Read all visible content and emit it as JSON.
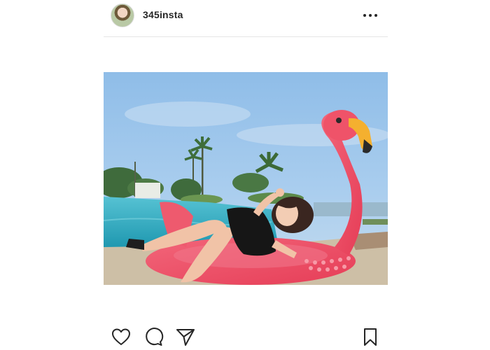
{
  "post": {
    "username": "345insta"
  },
  "icons": {
    "avatar": "profile-photo",
    "more": "more-options-icon",
    "like": "heart-icon",
    "comment": "comment-icon",
    "share": "paper-plane-icon",
    "save": "bookmark-icon"
  },
  "colors": {
    "text": "#262626",
    "divider": "#e6e6e6",
    "flamingo": "#ef4f64",
    "beak": "#f6b233",
    "pool": "#3fb2c6",
    "sky": "#95c2ea"
  }
}
